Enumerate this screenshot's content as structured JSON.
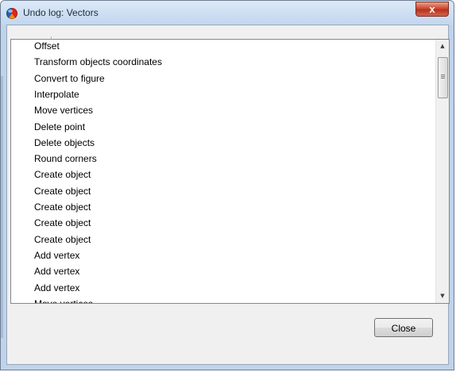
{
  "window": {
    "title": "Undo log: Vectors",
    "close_glyph": "x",
    "icon": "app-globe-icon"
  },
  "toolbar": {
    "undo_icon": "undo-icon",
    "redo_icon": "redo-icon",
    "delete_icon": "trash-icon"
  },
  "list": {
    "items": [
      "Offset",
      "Transform objects coordinates",
      "Convert to figure",
      "Interpolate",
      "Move vertices",
      "Delete point",
      "Delete objects",
      "Round corners",
      "Create object",
      "Create object",
      "Create object",
      "Create object",
      "Create object",
      "Add vertex",
      "Add vertex",
      "Add vertex",
      "Move vertices"
    ]
  },
  "footer": {
    "close_label": "Close"
  }
}
